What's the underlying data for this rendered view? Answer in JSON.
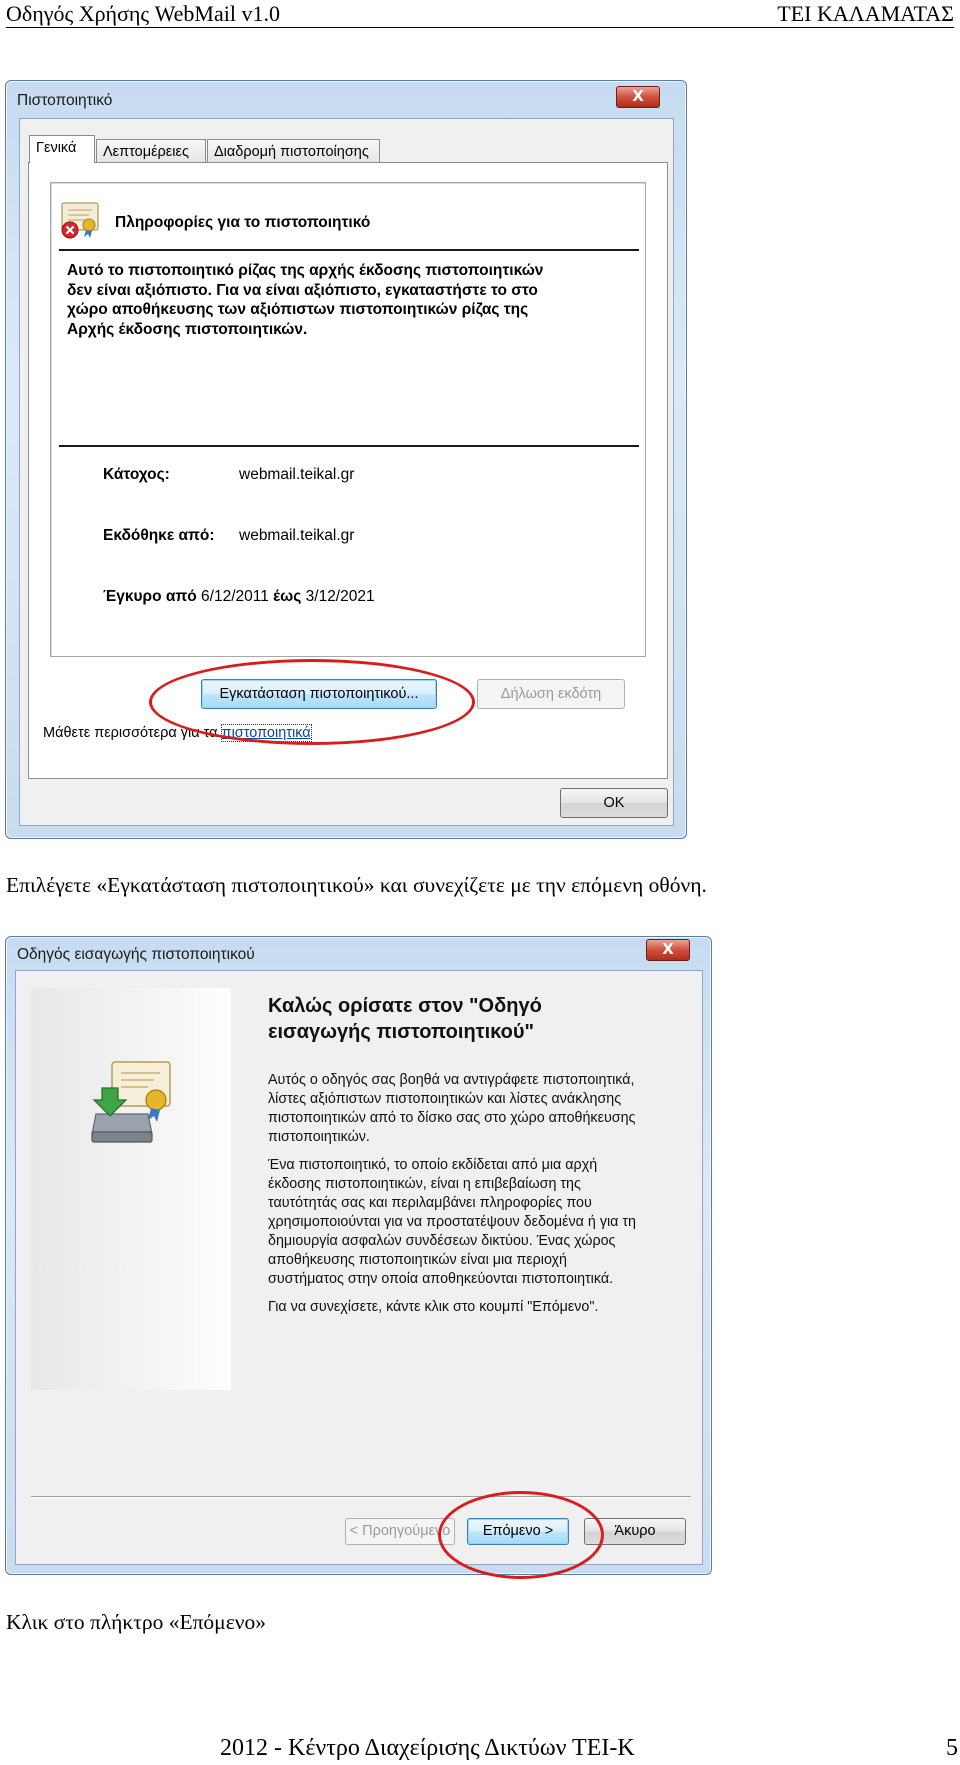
{
  "page_header": {
    "left": "Οδηγός Χρήσης WebMail v1.0",
    "right": "ΤΕΙ ΚΑΛΑΜΑΤΑΣ"
  },
  "cert_dialog": {
    "title": "Πιστοποιητικό",
    "close": "X",
    "tabs": [
      "Γενικά",
      "Λεπτομέρειες",
      "Διαδρομή πιστοποίησης"
    ],
    "info_heading": "Πληροφορίες για το πιστοποιητικό",
    "warning_lines": [
      "Αυτό το πιστοποιητικό ρίζας της αρχής έκδοσης πιστοποιητικών",
      "δεν είναι αξιόπιστο. Για να είναι αξιόπιστο, εγκαταστήστε το στο",
      "χώρο αποθήκευσης των αξιόπιστων πιστοποιητικών ρίζας της",
      "Αρχής έκδοσης πιστοποιητικών."
    ],
    "holder_label": "Κάτοχος:",
    "holder_value": "webmail.teikal.gr",
    "issuer_label": "Εκδόθηκε από:",
    "issuer_value": "webmail.teikal.gr",
    "valid_label": "Έγκυρο από",
    "valid_from": "6/12/2011",
    "valid_to_label": "έως",
    "valid_to": "3/12/2021",
    "install_button": "Εγκατάσταση πιστοποιητικού...",
    "issuer_statement_button": "Δήλωση εκδότη",
    "learn_more_prefix": "Μάθετε περισσότερα για τα",
    "learn_more_link": "πιστοποιητικά",
    "ok_button": "OK"
  },
  "caption1": "Επιλέγετε «Εγκατάσταση πιστοποιητικού» και συνεχίζετε με την επόμενη οθόνη.",
  "wizard_dialog": {
    "title": "Οδηγός εισαγωγής πιστοποιητικού",
    "close": "X",
    "heading_lines": [
      "Καλώς ορίσατε στον \"Οδηγό",
      "εισαγωγής πιστοποιητικού\""
    ],
    "para1": [
      "Αυτός ο οδηγός σας βοηθά να αντιγράφετε πιστοποιητικά,",
      "λίστες αξιόπιστων πιστοποιητικών και λίστες ανάκλησης",
      "πιστοποιητικών από το δίσκο σας στο χώρο αποθήκευσης",
      "πιστοποιητικών."
    ],
    "para2": [
      "Ένα πιστοποιητικό, το οποίο εκδίδεται από μια αρχή",
      "έκδοσης πιστοποιητικών, είναι η επιβεβαίωση της",
      "ταυτότητάς σας και περιλαμβάνει πληροφορίες που",
      "χρησιμοποιούνται για να προστατέψουν δεδομένα ή για τη",
      "δημιουργία ασφαλών συνδέσεων δικτύου. Ένας χώρος",
      "αποθήκευσης πιστοποιητικών είναι μια περιοχή",
      "συστήματος στην οποία αποθηκεύονται πιστοποιητικά."
    ],
    "para3": "Για να συνεχίσετε, κάντε κλικ στο κουμπί \"Επόμενο\".",
    "back_button": "< Προηγούμενο",
    "next_button": "Επόμενο >",
    "cancel_button": "Άκυρο"
  },
  "caption2": "Κλικ στο πλήκτρο «Επόμενο»",
  "footer": {
    "text": "2012 - Κέντρο Διαχείρισης Δικτύων ΤΕΙ-Κ",
    "page_number": "5"
  },
  "colors": {
    "highlight_ellipse": "#d81d1d",
    "window_frame": "#c6dcf2",
    "link": "#0645ad"
  },
  "icons": [
    "certificate-error-icon",
    "certificate-install-icon",
    "close-icon"
  ]
}
